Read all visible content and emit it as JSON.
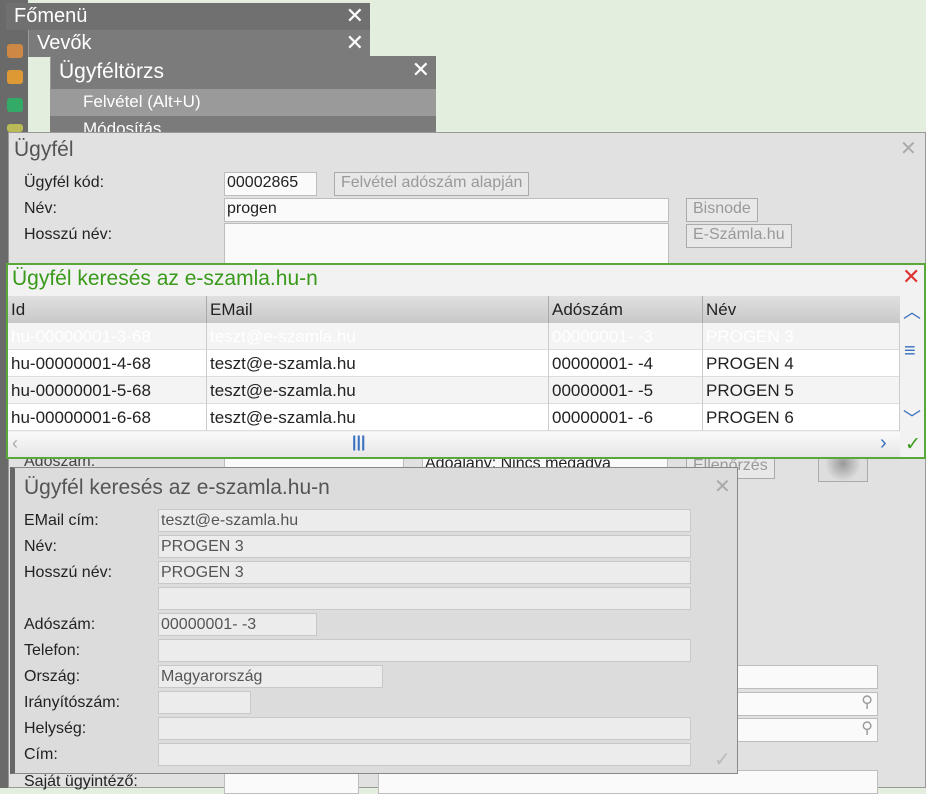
{
  "menus": {
    "main": "Főmenü",
    "customers": "Vevők",
    "registry": "Ügyféltörzs",
    "items": [
      "Felvétel (Alt+U)",
      "Módosítás"
    ]
  },
  "customer_form": {
    "title": "Ügyfél",
    "code_label": "Ügyfél kód:",
    "code_value": "00002865",
    "add_by_tax_button": "Felvétel adószám alapján",
    "name_label": "Név:",
    "name_value": "progen",
    "long_name_label": "Hosszú név:",
    "bisnode_button": "Bisnode",
    "eszamla_button": "E-Számla.hu",
    "tax_label": "Adószám:",
    "taxpayer_select": "Adóalany: Nincs megadva",
    "check_button": "Ellenőrzés",
    "agent_label": "Saját ügyintéző:"
  },
  "search_dialog": {
    "title": "Ügyfél keresés az e-szamla.hu-n",
    "columns": [
      "Id",
      "EMail",
      "Adószám",
      "Név"
    ],
    "rows": [
      {
        "id": "hu-00000001-3-68",
        "email": "teszt@e-szamla.hu",
        "tax": "00000001- -3",
        "name": "PROGEN 3"
      },
      {
        "id": "hu-00000001-4-68",
        "email": "teszt@e-szamla.hu",
        "tax": "00000001- -4",
        "name": "PROGEN 4"
      },
      {
        "id": "hu-00000001-5-68",
        "email": "teszt@e-szamla.hu",
        "tax": "00000001- -5",
        "name": "PROGEN 5"
      },
      {
        "id": "hu-00000001-6-68",
        "email": "teszt@e-szamla.hu",
        "tax": "00000001- -6",
        "name": "PROGEN 6"
      }
    ],
    "selected_row": 0
  },
  "detail_dialog": {
    "title": "Ügyfél keresés az e-szamla.hu-n",
    "email_label": "EMail cím:",
    "email": "teszt@e-szamla.hu",
    "name_label": "Név:",
    "name": "PROGEN 3",
    "long_name_label": "Hosszú név:",
    "long_name": "PROGEN 3",
    "tax_label": "Adószám:",
    "tax": "00000001- -3",
    "phone_label": "Telefon:",
    "country_label": "Ország:",
    "country": "Magyarország",
    "zip_label": "Irányítószám:",
    "city_label": "Helység:",
    "address_label": "Cím:"
  },
  "colors": {
    "accent": "#4a9a2a",
    "menu": "#7b7b7b"
  }
}
